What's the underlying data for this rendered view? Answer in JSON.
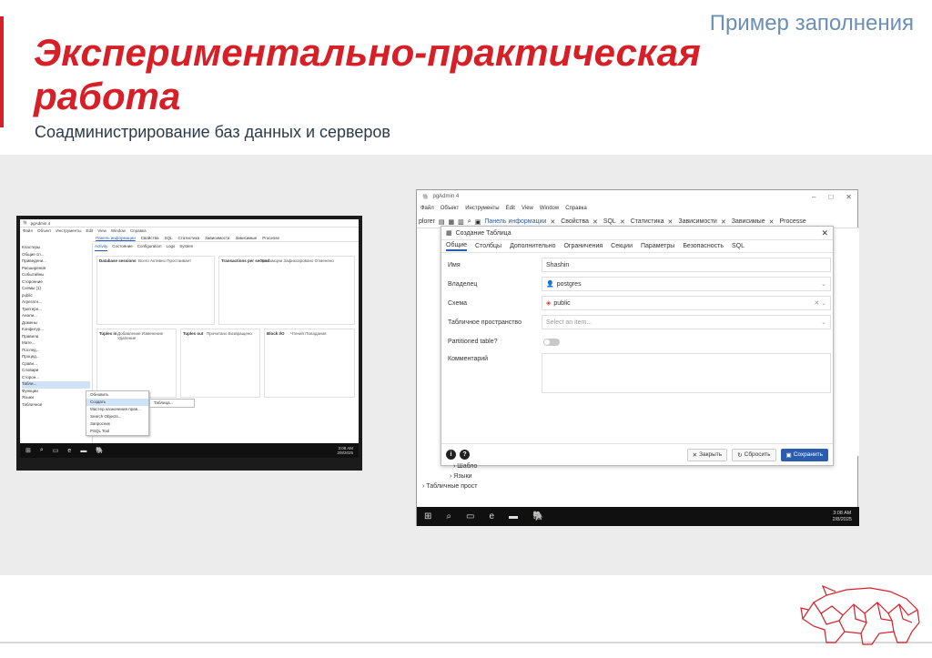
{
  "header": {
    "corner_label": "Пример заполнения",
    "title": "Экспериментально-практическая работа",
    "subtitle": "Соадминистрирование баз данных и серверов"
  },
  "colors": {
    "accent": "#d61f26",
    "corner_label": "#6b8fb5",
    "primary_button": "#2a5db0"
  },
  "small_screenshot": {
    "window_title": "pgAdmin 4",
    "menu": [
      "Файл",
      "Объект",
      "Инструменты",
      "Edit",
      "View",
      "Window",
      "Справка"
    ],
    "toolbar_tabs": [
      "Панель информации",
      "Свойства",
      "SQL",
      "Статистика",
      "Зависимости",
      "Зависимые",
      "Processe"
    ],
    "sub_tabs": [
      "Activity",
      "Состояние",
      "Configuration",
      "Logs",
      "System"
    ],
    "tree": [
      "Кластеры",
      "Общие сп...",
      "Приведени...",
      "Расширения",
      "Событийны",
      "Сторонние",
      "Схемы (1)",
      "public",
      "Агрегатн...",
      "Триггерн...",
      "Анали...",
      "Домены",
      "Конфигур...",
      "Правила",
      "Мате...",
      "Послед...",
      "Процед...",
      "Сравн...",
      "Словари",
      "Сторон...",
      "Табли...",
      "Функции",
      "Языки",
      "Табличное"
    ],
    "cards": [
      {
        "title": "Database sessions",
        "legend": "Всего  Активно  Простаивает"
      },
      {
        "title": "Transactions per second",
        "legend": "Транзакции  Зафиксировано  Отменено"
      },
      {
        "title": "Tuples in",
        "legend": "Добавление  Изменение  Удаление"
      },
      {
        "title": "Tuples out",
        "legend": "Прочитано  Возвращено"
      },
      {
        "title": "Block I/O",
        "legend": "Чтения  Попадания"
      }
    ],
    "context_menu": [
      "Обновить",
      "Создать",
      "Мастер назначения прав...",
      "Search Objects...",
      "Запросник",
      "PSQL Tool"
    ],
    "submenu_item": "Таблица...",
    "clock_time": "3:08 AM",
    "clock_date": "2/8/2025"
  },
  "large_screenshot": {
    "window_title": "pgAdmin 4",
    "menu": [
      "Файл",
      "Объект",
      "Инструменты",
      "Edit",
      "View",
      "Window",
      "Справка"
    ],
    "explorer_label": "plorer",
    "toolbar_tabs": [
      "Панель информации",
      "Свойства",
      "SQL",
      "Статистика",
      "Зависимости",
      "Зависимые",
      "Processe"
    ],
    "dialog": {
      "title": "Создание Таблица",
      "tabs": [
        "Общие",
        "Столбцы",
        "Дополнительно",
        "Ограничения",
        "Секции",
        "Параметры",
        "Безопасность",
        "SQL"
      ],
      "fields": {
        "name_label": "Имя",
        "name_value": "Shashin",
        "owner_label": "Владелец",
        "owner_value": "postgres",
        "schema_label": "Схема",
        "schema_value": "public",
        "tablespace_label": "Табличное пространство",
        "tablespace_placeholder": "Select an item...",
        "partitioned_label": "Partitioned table?",
        "comment_label": "Комментарий"
      },
      "buttons": {
        "close": "Закрыть",
        "reset": "Сбросить",
        "save": "Сохранить"
      }
    },
    "tree_bottom": [
      "Шабло",
      "Языки",
      "Табличные прост"
    ],
    "clock_time": "3:08 AM",
    "clock_date": "2/8/2025"
  }
}
